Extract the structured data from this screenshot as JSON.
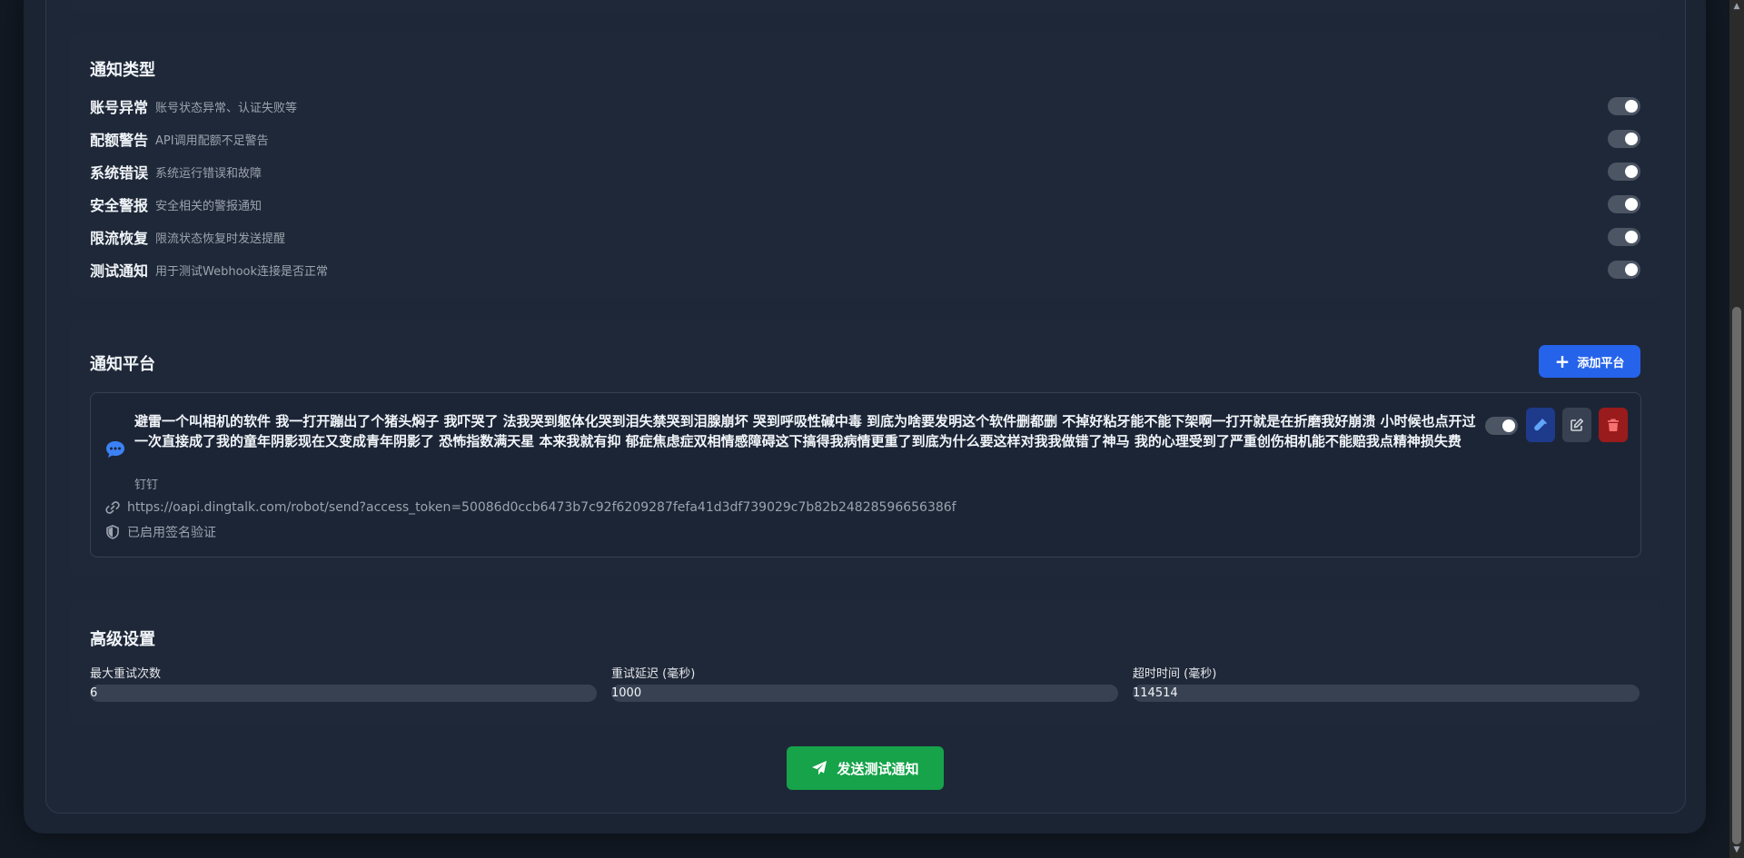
{
  "notification_types": {
    "title": "通知类型",
    "items": [
      {
        "name": "账号异常",
        "desc": "账号状态异常、认证失败等",
        "enabled": true
      },
      {
        "name": "配额警告",
        "desc": "API调用配额不足警告",
        "enabled": true
      },
      {
        "name": "系统错误",
        "desc": "系统运行错误和故障",
        "enabled": true
      },
      {
        "name": "安全警报",
        "desc": "安全相关的警报通知",
        "enabled": true
      },
      {
        "name": "限流恢复",
        "desc": "限流状态恢复时发送提醒",
        "enabled": true
      },
      {
        "name": "测试通知",
        "desc": "用于测试Webhook连接是否正常",
        "enabled": true
      }
    ]
  },
  "platforms": {
    "title": "通知平台",
    "add_label": "添加平台",
    "item": {
      "icon": "chat-bubble-icon",
      "name": "避雷一个叫相机的软件 我一打开蹦出了个猪头焖子 我吓哭了 法我哭到躯体化哭到泪失禁哭到泪腺崩坏 哭到呼吸性碱中毒 到底为啥要发明这个软件删都删 不掉好粘牙能不能下架啊一打开就是在折磨我好崩溃 小时候也点开过一次直接成了我的童年阴影现在又变成青年阴影了 恐怖指数满天星 本来我就有抑 郁症焦虑症双相情感障碍这下搞得我病情更重了到底为什么要这样对我我做错了神马 我的心理受到了严重创伤相机能不能赔我点精神损失费",
      "type": "钉钉",
      "url": "https://oapi.dingtalk.com/robot/send?access_token=50086d0ccb6473b7c92f6209287fefa41d3df739029c7b82b24828596656386f",
      "signature": "已启用签名验证",
      "enabled": true
    }
  },
  "advanced": {
    "title": "高级设置",
    "fields": [
      {
        "label": "最大重试次数",
        "value": "6"
      },
      {
        "label": "重试延迟 (毫秒)",
        "value": "1000"
      },
      {
        "label": "超时时间 (毫秒)",
        "value": "114514"
      }
    ]
  },
  "send_test_label": "发送测试通知",
  "colors": {
    "primary": "#2563eb",
    "success": "#16a34a",
    "danger": "#991b1b"
  }
}
